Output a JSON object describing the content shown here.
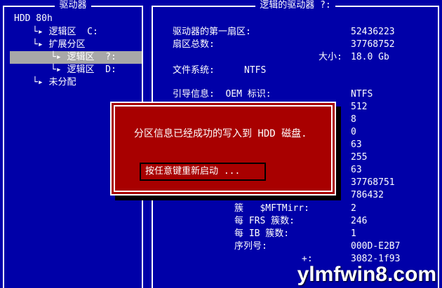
{
  "left_panel": {
    "title": "驱动器",
    "tree": [
      {
        "text": "HDD 80h"
      },
      {
        "text": "└▸ 逻辑区  C:"
      },
      {
        "text": "└▸ 扩展分区"
      },
      {
        "text": "└▸ 逻辑区  ?:"
      },
      {
        "text": "└▸ 逻辑区  D:"
      },
      {
        "text": "└▸ 未分配"
      }
    ]
  },
  "right_panel": {
    "title": "逻辑的驱动器  ?:",
    "first_sector_label": "驱动器的第一扇区:",
    "first_sector_value": "52436223",
    "total_sectors_label": "扇区总数:",
    "total_sectors_value": "37768752",
    "size_label": "大小:",
    "size_value": "18.0 Gb",
    "fs_label": "文件系统:",
    "fs_value": "NTFS",
    "boot_label": "引导信息:  OEM 标识:",
    "boot_value": "NTFS",
    "values": [
      "512",
      "8",
      "0",
      "63",
      "255",
      "63",
      "37768751",
      "786432"
    ],
    "mftmirr_label": "簇   $MFTMirr:",
    "mftmirr_value": "2",
    "frs_label": "每 FRS 簇数:",
    "frs_value": "246",
    "ib_label": "每 IB 簇数:",
    "ib_value": "1",
    "serial_label": "序列号:",
    "serial_value": "000D-E2B7",
    "partial_label": "+:",
    "partial_value": "3082-1f93"
  },
  "dialog": {
    "message": "分区信息已经成功的写入到 HDD 磁盘.",
    "button": "按任意键重新启动 ..."
  },
  "watermark": "ylmfwin8.com",
  "colors": {
    "background": "#0000a8",
    "dialog": "#a80000",
    "selection": "#a8a8a8",
    "text": "#ffffff"
  }
}
